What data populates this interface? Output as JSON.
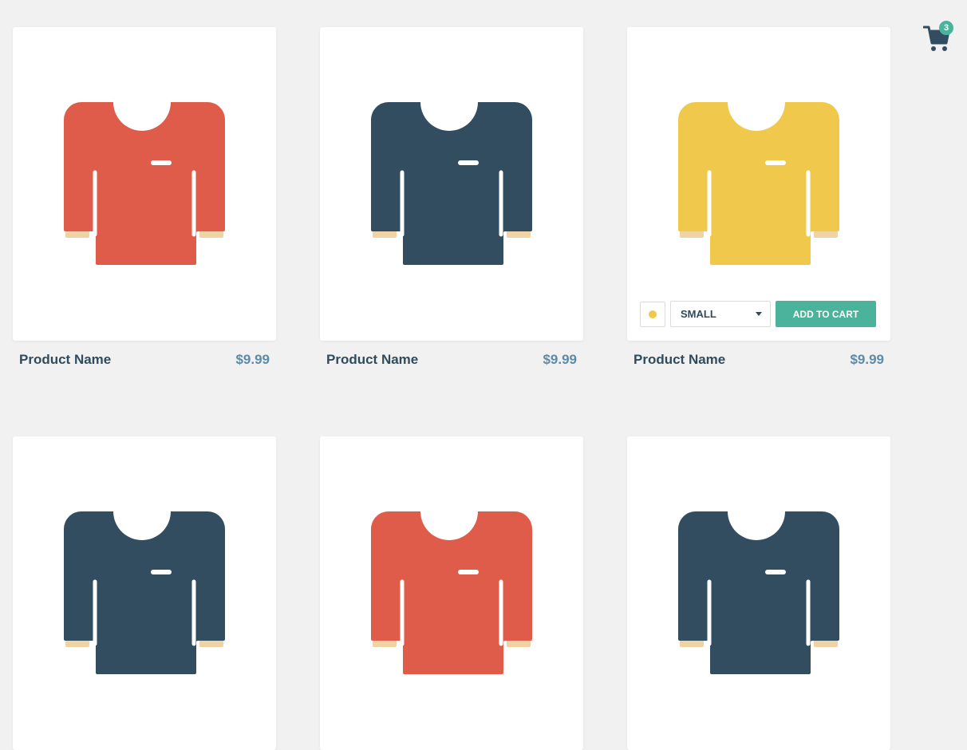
{
  "cart": {
    "icon": "cart-icon",
    "count": "3",
    "badge_color": "#4bb39c"
  },
  "products": [
    {
      "name": "Product Name",
      "price": "$9.99",
      "shirt_color": "#e05c4a"
    },
    {
      "name": "Product Name",
      "price": "$9.99",
      "shirt_color": "#324d60"
    },
    {
      "name": "Product Name",
      "price": "$9.99",
      "shirt_color": "#f0c94c",
      "hovered": true,
      "controls": {
        "color_dot": "#f0c94c",
        "size_selected": "SMALL",
        "add_to_cart_label": "ADD TO CART"
      }
    },
    {
      "shirt_color": "#324d60"
    },
    {
      "shirt_color": "#e05c4a"
    },
    {
      "shirt_color": "#324d60"
    }
  ],
  "colors": {
    "background": "#f1f1f1",
    "accent": "#4bb39c",
    "text_dark": "#2f4b5c",
    "price": "#5d8aa8",
    "cuff": "#efd3a5"
  }
}
